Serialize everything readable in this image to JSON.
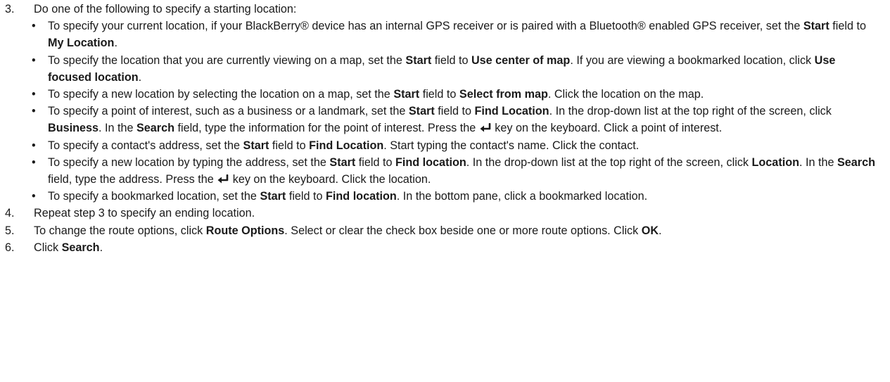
{
  "step3": {
    "number": "3.",
    "intro": "Do one of the following to specify a starting location:",
    "bullets": [
      {
        "t1": "To specify your current location, if your BlackBerry® device has an internal GPS receiver or is paired with a Bluetooth® enabled GPS receiver, set the ",
        "b1": "Start",
        "t2": " field to ",
        "b2": "My Location",
        "t3": "."
      },
      {
        "t1": "To specify the location that you are currently viewing on a map, set the ",
        "b1": "Start",
        "t2": " field to ",
        "b2": "Use center of map",
        "t3": ". If you are viewing a bookmarked location, click ",
        "b3": "Use focused location",
        "t4": "."
      },
      {
        "t1": "To specify a new location by selecting the location on a map, set the ",
        "b1": "Start",
        "t2": " field to ",
        "b2": "Select from map",
        "t3": ". Click the location on the map."
      },
      {
        "t1": "To specify a point of interest, such as a business or a landmark, set the ",
        "b1": "Start",
        "t2": " field to ",
        "b2": "Find Location",
        "t3": ". In the drop-down list at the top right of the screen, click ",
        "b3": "Business",
        "t4": ". In the ",
        "b4": "Search",
        "t5": " field, type the information for the point of interest. Press the ",
        "t6": " key on the keyboard. Click a point of interest."
      },
      {
        "t1": "To specify a contact's address, set the ",
        "b1": "Start",
        "t2": " field to ",
        "b2": "Find Location",
        "t3": ". Start typing the contact's name. Click the contact."
      },
      {
        "t1": "To specify a new location by typing the address, set the ",
        "b1": "Start",
        "t2": " field to ",
        "b2": "Find location",
        "t3": ". In the drop-down list at the top right of the screen, click ",
        "b3": "Location",
        "t4": ". In the ",
        "b4": "Search",
        "t5": " field, type the address. Press the ",
        "t6": " key on the keyboard. Click the location."
      },
      {
        "t1": "To specify a bookmarked location, set the ",
        "b1": "Start",
        "t2": " field to ",
        "b2": "Find location",
        "t3": ". In the bottom pane, click a bookmarked location."
      }
    ]
  },
  "step4": {
    "number": "4.",
    "text": "Repeat step 3 to specify an ending location."
  },
  "step5": {
    "number": "5.",
    "t1": "To change the route options, click ",
    "b1": "Route Options",
    "t2": ". Select or clear the check box beside one or more route options. Click ",
    "b2": "OK",
    "t3": "."
  },
  "step6": {
    "number": "6.",
    "t1": "Click ",
    "b1": "Search",
    "t2": "."
  },
  "bullet_symbol": "•",
  "icons": {
    "enter_key": "enter-key-icon"
  }
}
